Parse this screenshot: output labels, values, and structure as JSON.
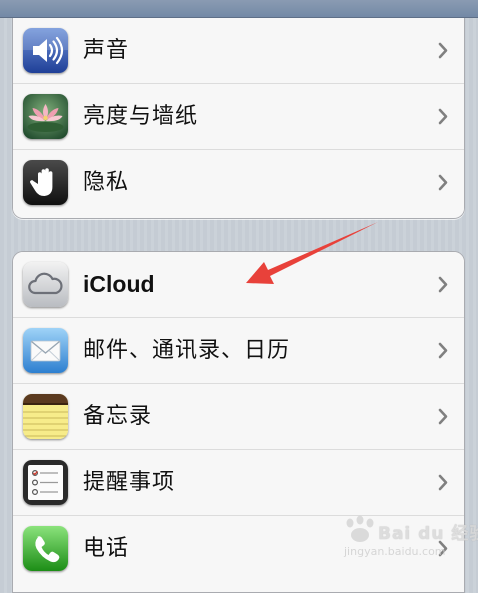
{
  "settings_group_1": {
    "items": [
      {
        "label": "声音",
        "icon": "sound-icon"
      },
      {
        "label": "亮度与墙纸",
        "icon": "brightness-wallpaper-icon"
      },
      {
        "label": "隐私",
        "icon": "privacy-hand-icon"
      }
    ]
  },
  "settings_group_2": {
    "items": [
      {
        "label": "iCloud",
        "icon": "icloud-icon"
      },
      {
        "label": "邮件、通讯录、日历",
        "icon": "mail-icon"
      },
      {
        "label": "备忘录",
        "icon": "notes-icon"
      },
      {
        "label": "提醒事项",
        "icon": "reminders-icon"
      },
      {
        "label": "电话",
        "icon": "phone-icon"
      }
    ]
  },
  "annotation": {
    "arrow_color": "#e8413a"
  },
  "watermark": {
    "text": "Bai du 经验",
    "subtext": "jingyan.baidu.com"
  },
  "colors": {
    "background": "#c5ccd4",
    "cell": "#f7f7f7",
    "chevron": "#808080"
  }
}
